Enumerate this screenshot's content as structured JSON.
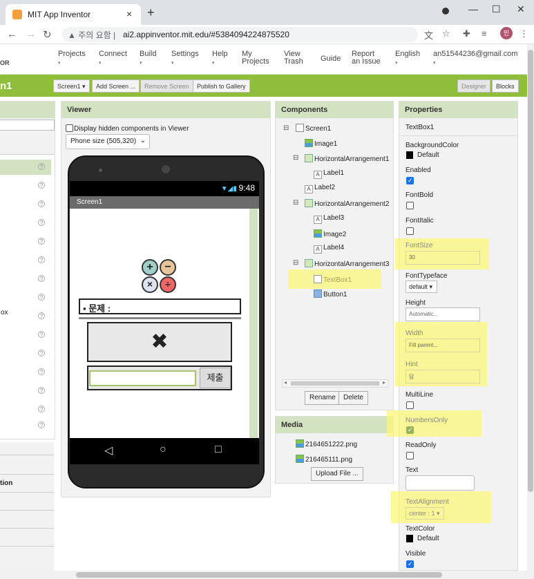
{
  "browser": {
    "tab_title": "MIT App Inventor",
    "tab_close": "×",
    "new_tab": "+",
    "security_warning": "주의 요함",
    "url": "ai2.appinventor.mit.edu/#5384094224875520",
    "profile_initial": "민"
  },
  "topnav": {
    "brand": "OR",
    "items": [
      {
        "label": "Projects",
        "arrow": "▾"
      },
      {
        "label": "Connect",
        "arrow": "▾"
      },
      {
        "label": "Build",
        "arrow": "▾"
      },
      {
        "label": "Settings",
        "arrow": "▾"
      },
      {
        "label": "Help",
        "arrow": "▾"
      },
      {
        "label": "My Projects",
        "arrow": ""
      },
      {
        "label": "View Trash",
        "arrow": ""
      },
      {
        "label": "Guide",
        "arrow": ""
      },
      {
        "label": "Report an Issue",
        "arrow": ""
      },
      {
        "label": "English",
        "arrow": "▾"
      },
      {
        "label": "an51544236@gmail.com",
        "arrow": "▾"
      }
    ]
  },
  "toolbar": {
    "project_name": "n1",
    "screen_select": "Screen1 ▾",
    "add_screen": "Add Screen ...",
    "remove_screen": "Remove Screen",
    "publish": "Publish to Gallery",
    "designer": "Designer",
    "blocks": "Blocks"
  },
  "palette": {
    "partial_item": "ox",
    "section_label": "tion",
    "help_glyph": "?"
  },
  "viewer": {
    "title": "Viewer",
    "hidden_label": "Display hidden components in Viewer",
    "phone_size": "Phone size (505,320)",
    "clock": "9:48",
    "screen_title": "Screen1",
    "question_label": "▪ 문제 :",
    "problem_symbol": "✖",
    "submit_label": "제출",
    "nav_back": "◁",
    "nav_home": "○",
    "nav_recent": "□"
  },
  "components": {
    "title": "Components",
    "tree": [
      {
        "name": "Screen1",
        "icon": "screen-icon",
        "toggle": "⊟"
      },
      {
        "name": "Image1",
        "icon": "image-icon",
        "toggle": ""
      },
      {
        "name": "HorizontalArrangement1",
        "icon": "arrangement-icon",
        "toggle": "⊟"
      },
      {
        "name": "Label1",
        "icon": "label-icon",
        "toggle": ""
      },
      {
        "name": "Label2",
        "icon": "label-icon",
        "toggle": ""
      },
      {
        "name": "HorizontalArrangement2",
        "icon": "arrangement-icon",
        "toggle": "⊟"
      },
      {
        "name": "Label3",
        "icon": "label-icon",
        "toggle": ""
      },
      {
        "name": "Image2",
        "icon": "image-icon",
        "toggle": ""
      },
      {
        "name": "Label4",
        "icon": "label-icon",
        "toggle": ""
      },
      {
        "name": "HorizontalArrangement3",
        "icon": "arrangement-icon",
        "toggle": "⊟"
      },
      {
        "name": "TextBox1",
        "icon": "textbox-icon",
        "toggle": ""
      },
      {
        "name": "Button1",
        "icon": "button-icon",
        "toggle": ""
      }
    ],
    "rename": "Rename",
    "delete": "Delete",
    "label_glyph": "A"
  },
  "media": {
    "title": "Media",
    "files": [
      "2164651222.png",
      "216465111.png"
    ],
    "upload": "Upload File ..."
  },
  "properties": {
    "title": "Properties",
    "component": "TextBox1",
    "background_color_label": "BackgroundColor",
    "background_color_value": "Default",
    "enabled_label": "Enabled",
    "fontbold_label": "FontBold",
    "fontitalic_label": "FontItalic",
    "fontsize_label": "FontSize",
    "fontsize_value": "30",
    "fonttypeface_label": "FontTypeface",
    "fonttypeface_value": "default ▾",
    "height_label": "Height",
    "height_value": "Automatic...",
    "width_label": "Width",
    "width_value": "Fill parent...",
    "hint_label": "Hint",
    "hint_value": "답",
    "multiline_label": "MultiLine",
    "numbersonly_label": "NumbersOnly",
    "readonly_label": "ReadOnly",
    "text_label": "Text",
    "textalignment_label": "TextAlignment",
    "textalignment_value": "center : 1 ▾",
    "textcolor_label": "TextColor",
    "textcolor_value": "Default",
    "visible_label": "Visible"
  },
  "colors": {
    "green_bar": "#8fbf3a",
    "panel_header": "#d3e2c0",
    "highlight": "#fbf77a"
  }
}
